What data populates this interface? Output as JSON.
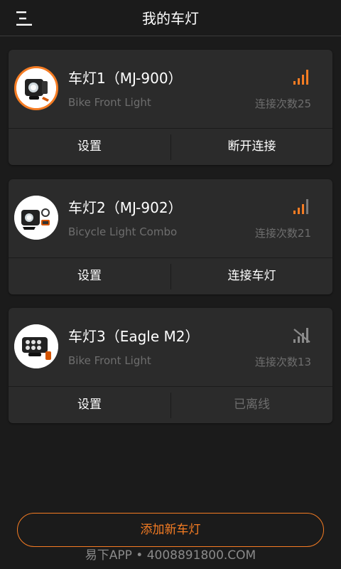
{
  "header": {
    "title": "我的车灯",
    "menu_icon": "menu-icon"
  },
  "colors": {
    "background": "#1b1b1b",
    "card": "#2b2b2b",
    "accent": "#f57c23",
    "muted_text": "#6e6e6e",
    "signal_off": "#8a8a8a"
  },
  "lights": [
    {
      "name": "车灯1（MJ-900）",
      "subtitle": "Bike Front Light",
      "connection_count": "连接次数25",
      "signal": "strong",
      "settings_label": "设置",
      "action_label": "断开连接",
      "action_enabled": true,
      "selected": true
    },
    {
      "name": "车灯2（MJ-902）",
      "subtitle": "Bicycle Light Combo",
      "connection_count": "连接次数21",
      "signal": "medium",
      "settings_label": "设置",
      "action_label": "连接车灯",
      "action_enabled": true,
      "selected": false
    },
    {
      "name": "车灯3（Eagle M2）",
      "subtitle": "Bike Front Light",
      "connection_count": "连接次数13",
      "signal": "none",
      "settings_label": "设置",
      "action_label": "已离线",
      "action_enabled": false,
      "selected": false
    }
  ],
  "add_button": {
    "label": "添加新车灯"
  },
  "watermark": {
    "text": "易下APP • 4008891800.COM"
  }
}
